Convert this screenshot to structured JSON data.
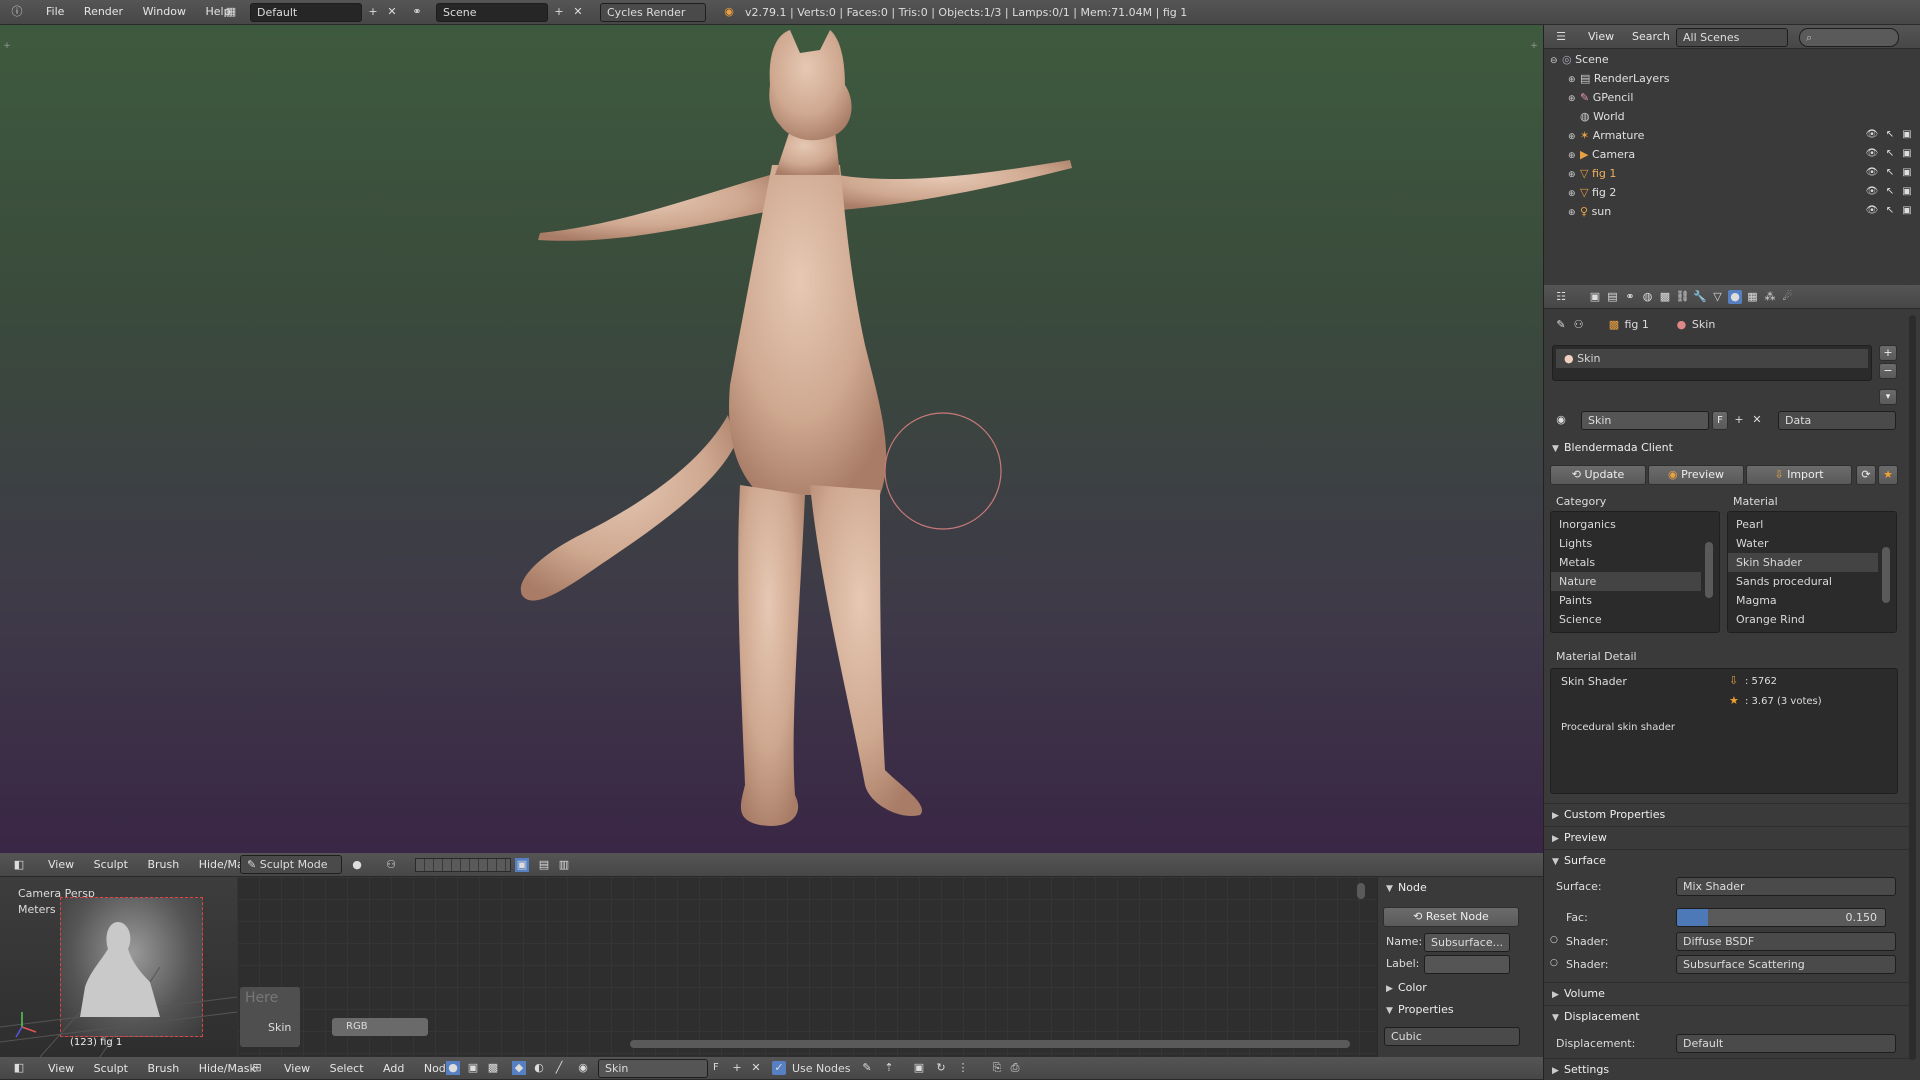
{
  "topbar": {
    "menus": [
      "File",
      "Render",
      "Window",
      "Help"
    ],
    "screen_layout": "Default",
    "scene": "Scene",
    "render_engine": "Cycles Render",
    "stats": "v2.79.1 | Verts:0 | Faces:0 | Tris:0 | Objects:1/3 | Lamps:0/1 | Mem:71.04M | fig 1"
  },
  "viewport": {
    "header_menus": [
      "View",
      "Sculpt",
      "Brush",
      "Hide/Mask"
    ],
    "mode": "Sculpt Mode"
  },
  "mini_view": {
    "label": "Camera Persp",
    "units": "Meters",
    "object_label": "(123) fig 1"
  },
  "node_editor": {
    "here_label": "Here",
    "skin_label": "Skin",
    "rgb_label": "RGB",
    "panel_title": "Node",
    "reset_node": "Reset Node",
    "name_label": "Name:",
    "name_value": "Subsurface...",
    "label_label": "Label:",
    "label_value": "",
    "color_panel": "Color",
    "properties_panel": "Properties",
    "properties_value": "Cubic"
  },
  "bottom_bar": {
    "left_menus": [
      "View",
      "Sculpt",
      "Brush",
      "Hide/Mask"
    ],
    "node_menus": [
      "View",
      "Select",
      "Add",
      "Node"
    ],
    "material": "Skin",
    "fake_user": "F",
    "use_nodes": "Use Nodes"
  },
  "outliner": {
    "menus": [
      "View",
      "Search"
    ],
    "scene_filter": "All Scenes",
    "items": [
      {
        "name": "Scene",
        "indent": 0,
        "icon": "scene-icon"
      },
      {
        "name": "RenderLayers",
        "indent": 1,
        "icon": "renderlayers-icon"
      },
      {
        "name": "GPencil",
        "indent": 1,
        "icon": "gpencil-icon"
      },
      {
        "name": "World",
        "indent": 1,
        "icon": "world-icon"
      },
      {
        "name": "Armature",
        "indent": 1,
        "icon": "armature-icon"
      },
      {
        "name": "Camera",
        "indent": 1,
        "icon": "camera-icon"
      },
      {
        "name": "fig 1",
        "indent": 1,
        "icon": "mesh-icon"
      },
      {
        "name": "fig 2",
        "indent": 1,
        "icon": "mesh-icon"
      },
      {
        "name": "sun",
        "indent": 1,
        "icon": "lamp-icon"
      }
    ]
  },
  "properties": {
    "breadcrumb": [
      "fig 1",
      "Skin"
    ],
    "slot_name": "Skin",
    "material_name": "Skin",
    "fake_user": "F",
    "link": "Data",
    "blendermada": {
      "title": "Blendermada Client",
      "update": "Update",
      "preview": "Preview",
      "import": "Import",
      "category_label": "Category",
      "material_label": "Material",
      "categories": [
        "Inorganics",
        "Lights",
        "Metals",
        "Nature",
        "Paints",
        "Science"
      ],
      "selected_category": "Nature",
      "materials": [
        "Pearl",
        "Water",
        "Skin Shader",
        "Sands procedural",
        "Magma",
        "Orange Rind"
      ],
      "selected_material": "Skin Shader",
      "detail_title": "Material Detail",
      "detail_name": "Skin Shader",
      "downloads": ": 5762",
      "rating": ": 3.67 (3 votes)",
      "description": "Procedural skin shader"
    },
    "panels": {
      "custom_properties": "Custom Properties",
      "preview": "Preview",
      "surface": "Surface",
      "volume": "Volume",
      "displacement": "Displacement",
      "settings": "Settings"
    },
    "surface": {
      "surface_label": "Surface:",
      "surface_value": "Mix Shader",
      "fac_label": "Fac:",
      "fac_value": "0.150",
      "fac_fraction": 0.15,
      "shader1_label": "Shader:",
      "shader1_value": "Diffuse BSDF",
      "shader2_label": "Shader:",
      "shader2_value": "Subsurface Scattering"
    },
    "displacement": {
      "label": "Displacement:",
      "value": "Default"
    }
  }
}
